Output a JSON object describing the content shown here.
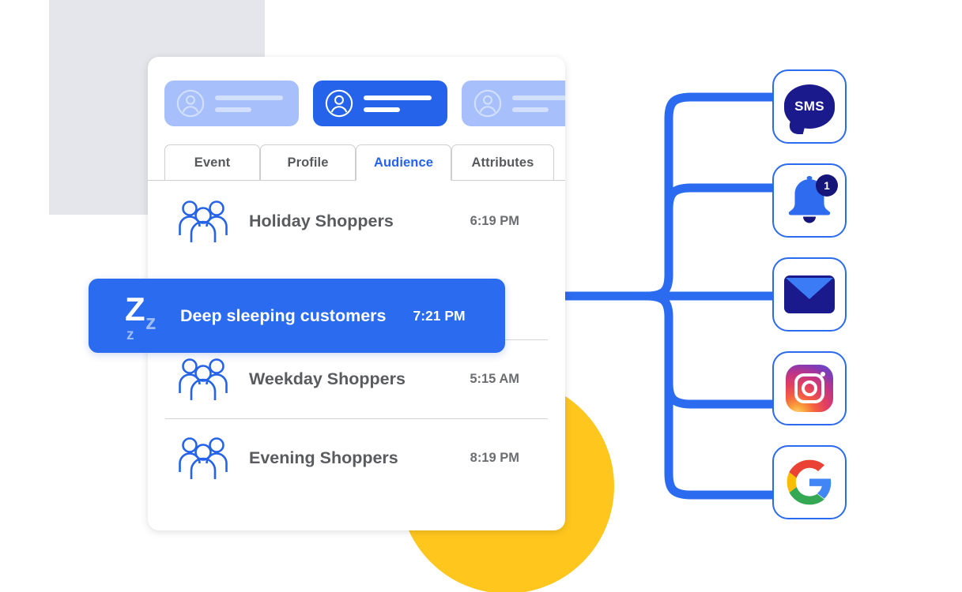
{
  "background": {
    "gray_shape_color": "#E4E6EB",
    "yellow_circle_color": "#FFC61E"
  },
  "card": {
    "accent_color": "#2563EB",
    "profile_pills": [
      {
        "state": "inactive",
        "avatar_icon": "user-avatar-icon"
      },
      {
        "state": "active",
        "avatar_icon": "user-avatar-icon"
      },
      {
        "state": "inactive",
        "avatar_icon": "user-avatar-icon"
      }
    ],
    "tabs": [
      {
        "label": "Event",
        "active": false
      },
      {
        "label": "Profile",
        "active": false
      },
      {
        "label": "Audience",
        "active": true
      },
      {
        "label": "Attributes",
        "active": false
      }
    ],
    "audience_list": [
      {
        "icon": "people-group-icon",
        "name": "Holiday Shoppers",
        "time": "6:19 PM"
      },
      {
        "icon": "people-group-icon",
        "name": "Weekday Shoppers",
        "time": "5:15 AM"
      },
      {
        "icon": "people-group-icon",
        "name": "Evening Shoppers",
        "time": "8:19 PM"
      }
    ],
    "selected_item": {
      "icon": "sleeping-zzz-icon",
      "z_large": "Z",
      "z_medium": "z",
      "z_small": "z",
      "name": "Deep sleeping customers",
      "time": "7:21 PM"
    }
  },
  "channels": [
    {
      "id": "sms",
      "icon": "sms-message-icon",
      "label": "SMS"
    },
    {
      "id": "push",
      "icon": "bell-notification-icon",
      "badge": "1"
    },
    {
      "id": "email",
      "icon": "envelope-mail-icon"
    },
    {
      "id": "instagram",
      "icon": "instagram-icon"
    },
    {
      "id": "google",
      "icon": "google-g-icon"
    }
  ],
  "connector": {
    "line_color": "#2B6BF0"
  }
}
